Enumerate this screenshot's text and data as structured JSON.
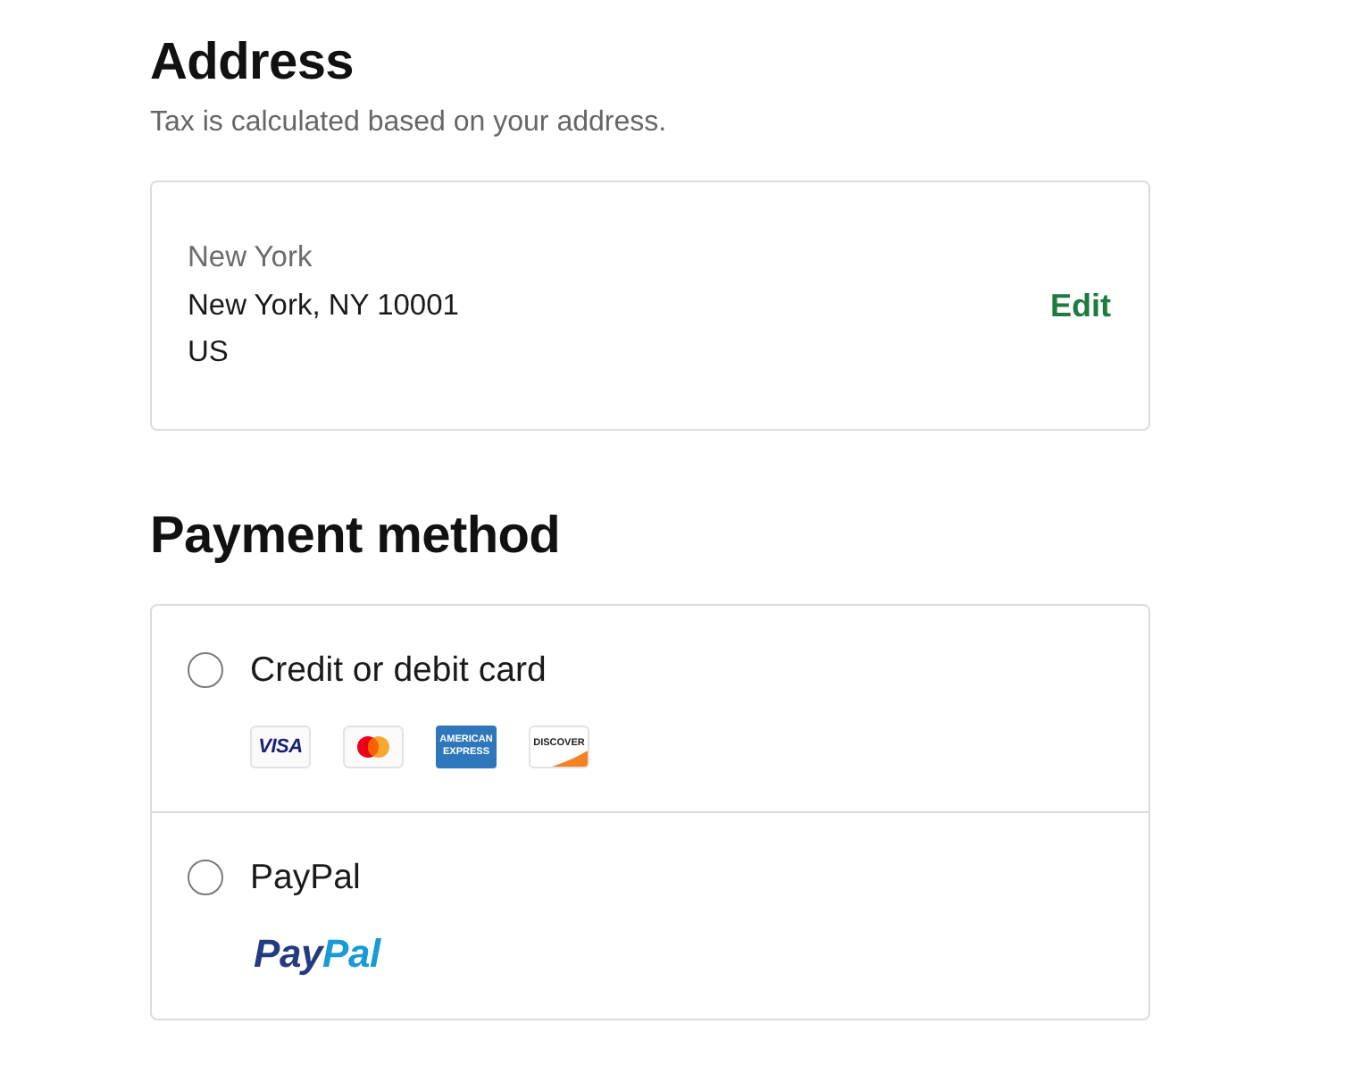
{
  "address_section": {
    "title": "Address",
    "subtitle": "Tax is calculated based on your address.",
    "lines": [
      {
        "text": "New York",
        "muted": true
      },
      {
        "text": "New York, NY 10001",
        "muted": false
      },
      {
        "text": "US",
        "muted": false
      }
    ],
    "action": "Edit"
  },
  "payment_section": {
    "title": "Payment method",
    "options": [
      {
        "kind": "card",
        "label": "Credit or debit card",
        "selected": false,
        "brands": [
          {
            "kind": "visa",
            "text": "VISA"
          },
          {
            "kind": "mastercard"
          },
          {
            "kind": "amex",
            "text": "AMERICAN EXPRESS"
          },
          {
            "kind": "discover",
            "text": "DISCOVER"
          }
        ]
      },
      {
        "kind": "paypal",
        "label": "PayPal",
        "selected": false,
        "logo": [
          {
            "text": "Pay",
            "color": "#253b80"
          },
          {
            "text": "Pal",
            "color": "#179bd7"
          }
        ]
      }
    ]
  }
}
